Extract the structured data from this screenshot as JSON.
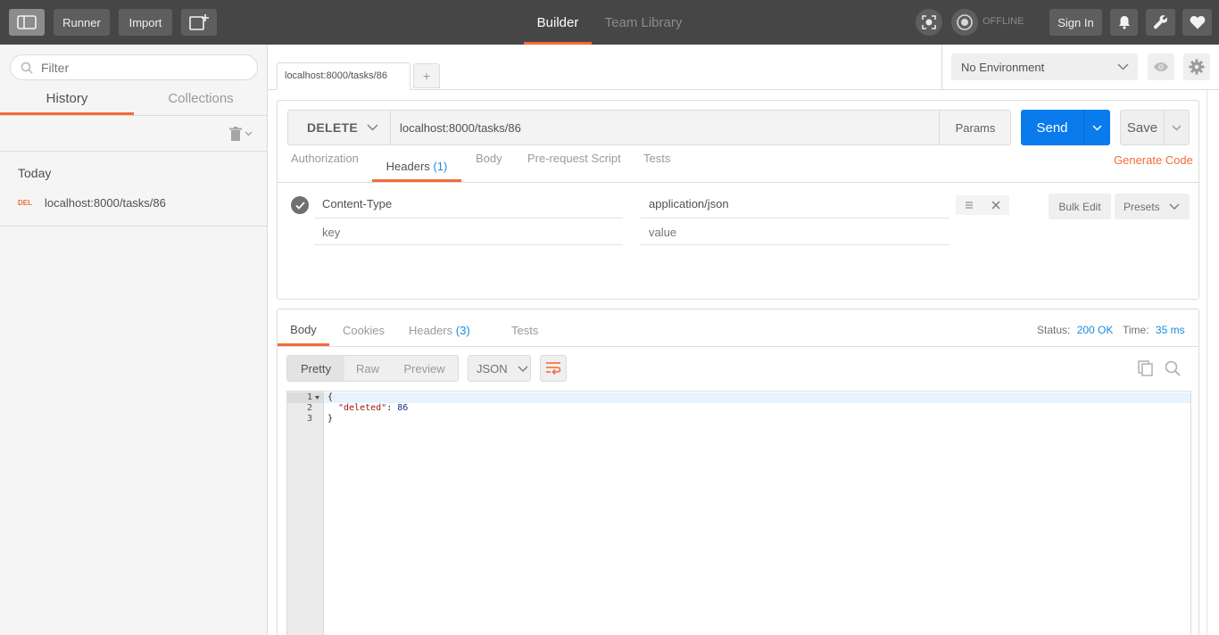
{
  "topbar": {
    "runner_label": "Runner",
    "import_label": "Import",
    "tabs": [
      {
        "label": "Builder",
        "active": true
      },
      {
        "label": "Team Library",
        "active": false
      }
    ],
    "offline_label": "OFFLINE",
    "signin_label": "Sign In"
  },
  "sidebar": {
    "filter_placeholder": "Filter",
    "tabs": [
      {
        "label": "History",
        "active": true
      },
      {
        "label": "Collections",
        "active": false
      }
    ],
    "group_label": "Today",
    "history_items": [
      {
        "method": "DEL",
        "url": "localhost:8000/tasks/86"
      }
    ]
  },
  "request_tab": {
    "label": "localhost:8000/tasks/86",
    "new_tab_label": "+"
  },
  "environment": {
    "selected": "No Environment"
  },
  "request": {
    "method": "DELETE",
    "url": "localhost:8000/tasks/86",
    "params_label": "Params",
    "send_label": "Send",
    "save_label": "Save",
    "tabs": [
      {
        "label": "Authorization",
        "count": ""
      },
      {
        "label": "Headers",
        "count": "(1)"
      },
      {
        "label": "Body",
        "count": ""
      },
      {
        "label": "Pre-request Script",
        "count": ""
      },
      {
        "label": "Tests",
        "count": ""
      }
    ],
    "generate_code_label": "Generate Code",
    "headers": [
      {
        "key": "Content-Type",
        "value": "application/json",
        "enabled": true
      }
    ],
    "key_placeholder": "key",
    "value_placeholder": "value",
    "bulk_edit_label": "Bulk Edit",
    "presets_label": "Presets"
  },
  "response": {
    "tabs": [
      {
        "label": "Body",
        "count": ""
      },
      {
        "label": "Cookies",
        "count": ""
      },
      {
        "label": "Headers",
        "count": "(3)"
      },
      {
        "label": "Tests",
        "count": ""
      }
    ],
    "status_label": "Status:",
    "status_value": "200 OK",
    "time_label": "Time:",
    "time_value": "35 ms",
    "view_modes": [
      "Pretty",
      "Raw",
      "Preview"
    ],
    "format": "JSON",
    "code_lines": [
      {
        "num": "1",
        "text": "{"
      },
      {
        "num": "2",
        "key": "\"deleted\"",
        "sep": ": ",
        "val": "86"
      },
      {
        "num": "3",
        "text": "}"
      }
    ]
  },
  "colors": {
    "accent": "#f26b3a",
    "send_blue": "#097bed",
    "topbar": "#464646",
    "link_blue": "#1a8ce0"
  }
}
